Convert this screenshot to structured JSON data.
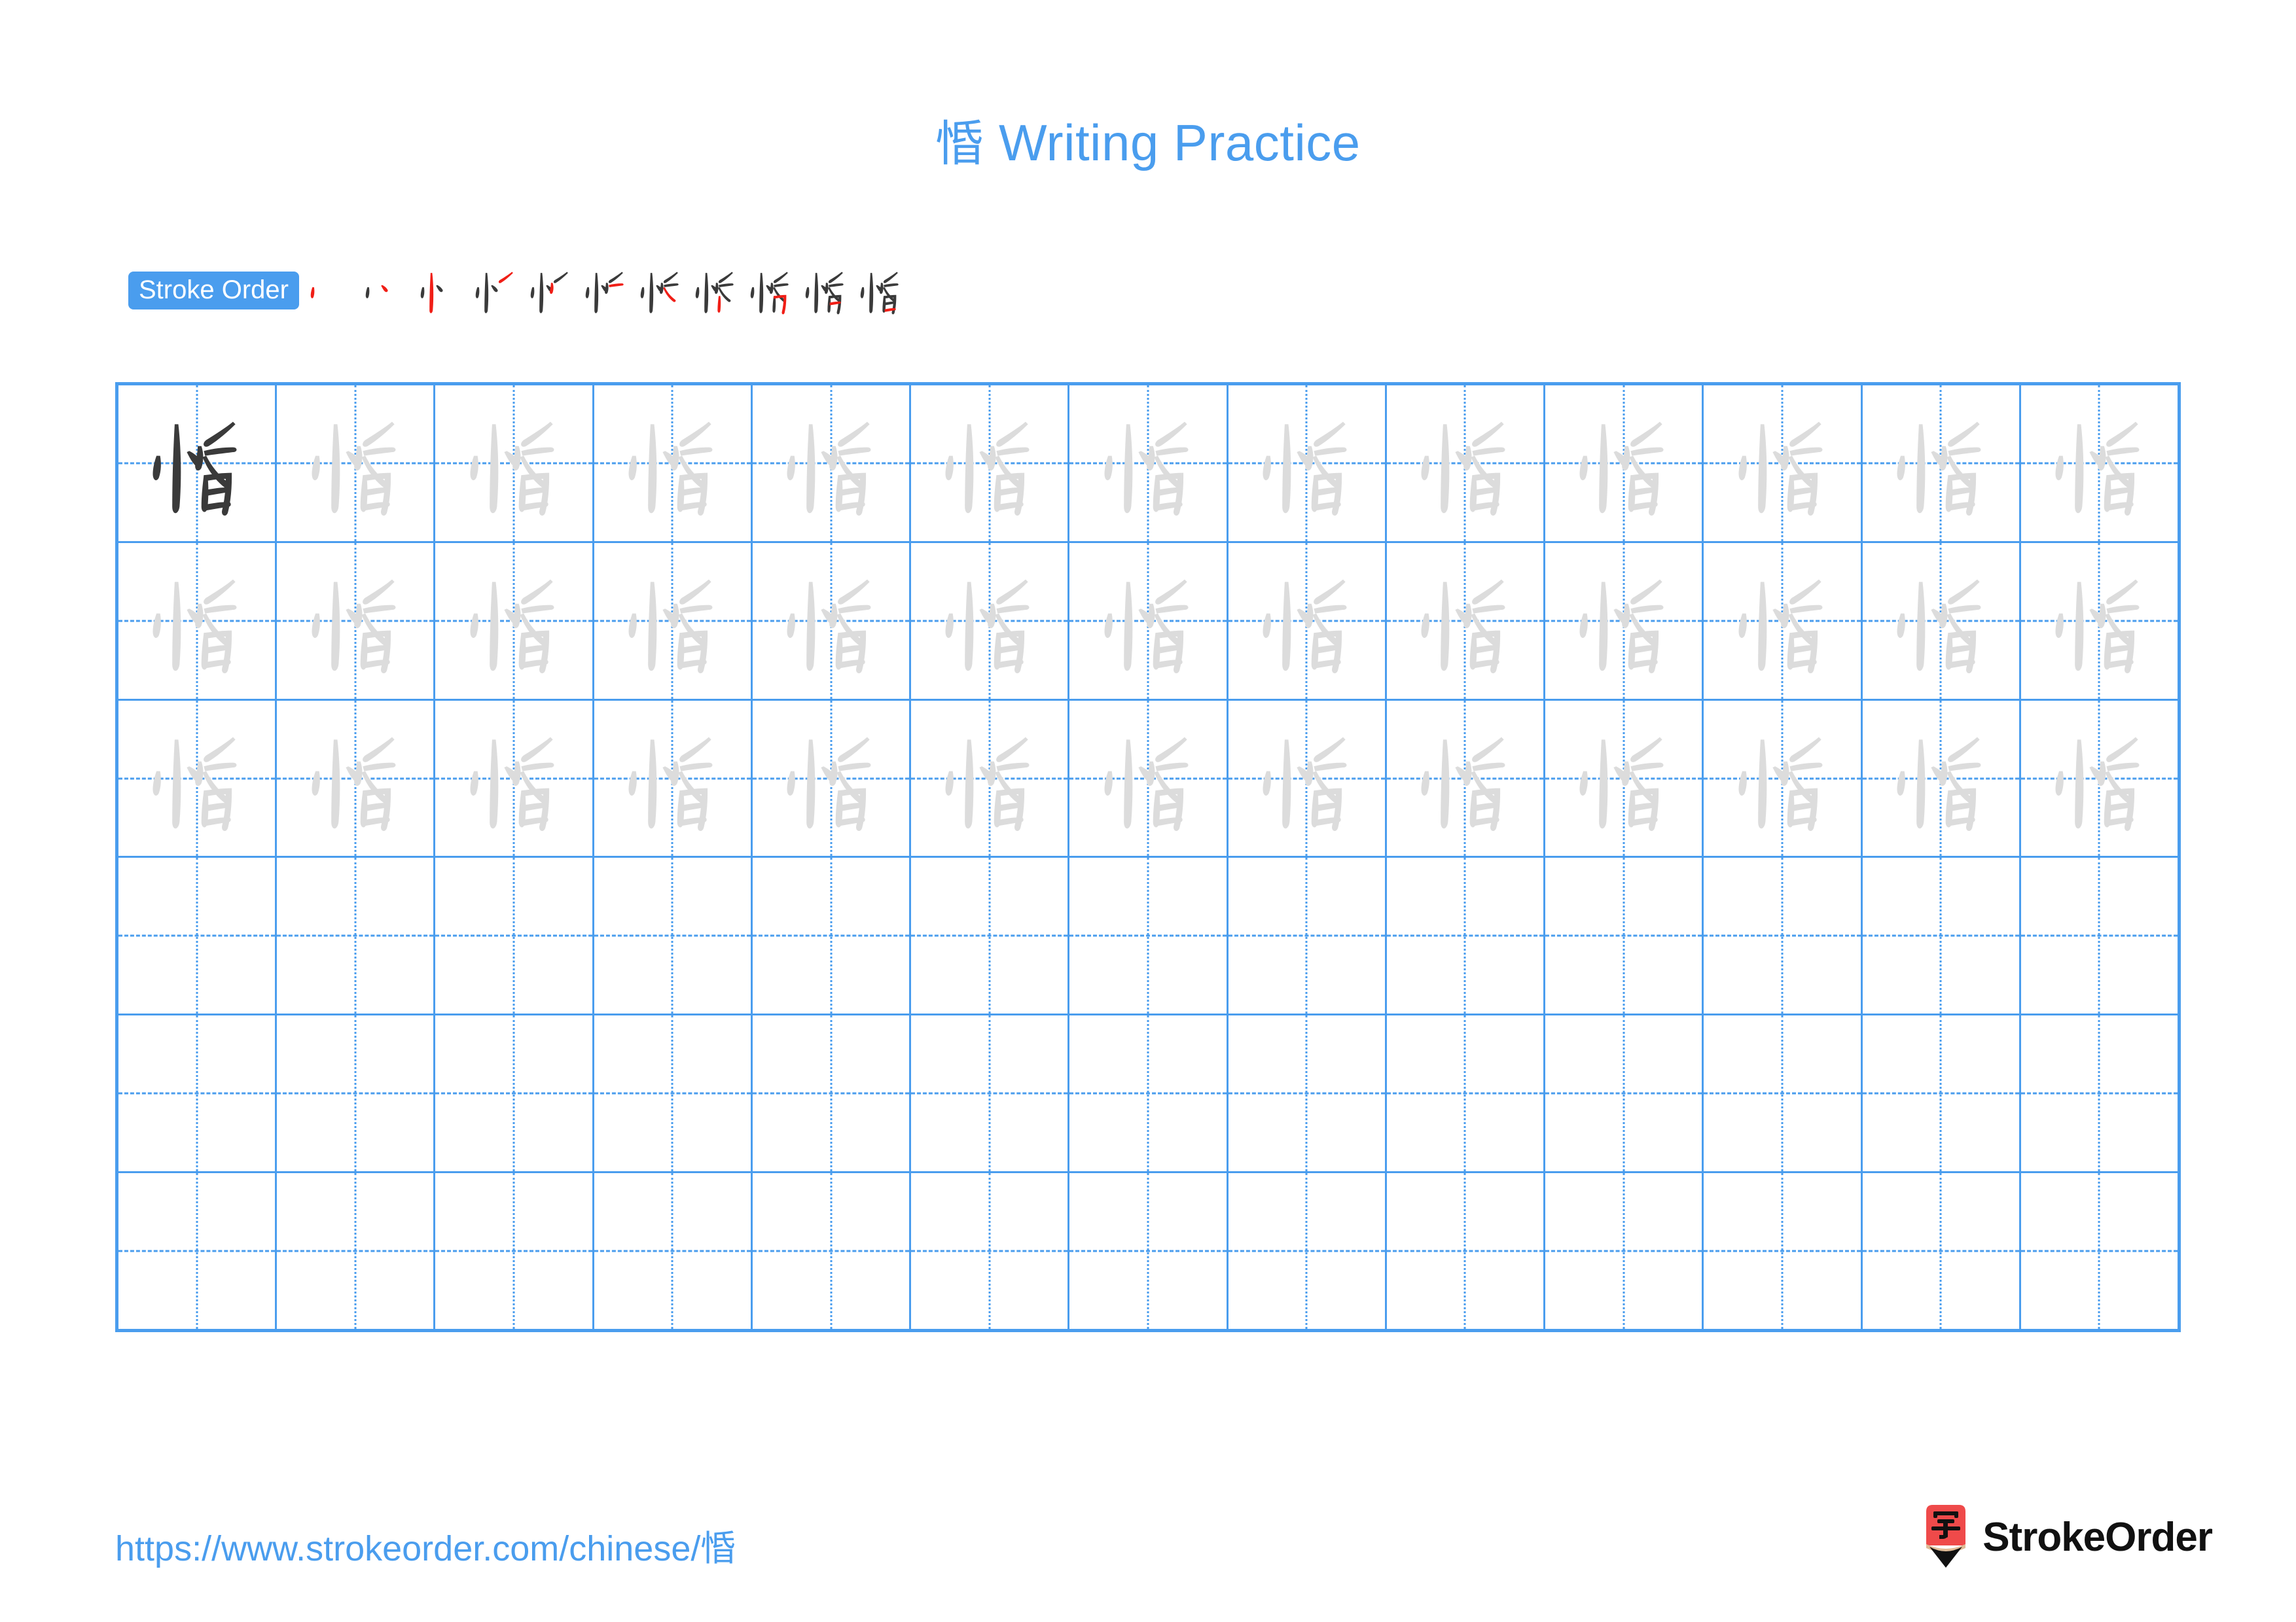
{
  "page": {
    "character": "惛",
    "title_suffix": "Writing Practice",
    "title_full": "惛 Writing Practice",
    "background_color": "#ffffff"
  },
  "colors": {
    "accent_blue": "#4A9DEE",
    "grid_blue": "#4A9DEE",
    "stroke_new_red": "#F01E16",
    "stroke_done_dark": "#3a3a3a",
    "trace_gray": "#dcdcdc",
    "logo_red": "#EF4A4A",
    "logo_wood_tan": "#E0BB96",
    "logo_tip_black": "#111111",
    "brand_text": "#111111"
  },
  "stroke_order": {
    "badge_label": "Stroke Order",
    "total_strokes": 11,
    "steps": [
      {
        "index": 1,
        "name": "stroke-step-1",
        "new_stroke": 1
      },
      {
        "index": 2,
        "name": "stroke-step-2",
        "new_stroke": 2
      },
      {
        "index": 3,
        "name": "stroke-step-3",
        "new_stroke": 3
      },
      {
        "index": 4,
        "name": "stroke-step-4",
        "new_stroke": 4
      },
      {
        "index": 5,
        "name": "stroke-step-5",
        "new_stroke": 5
      },
      {
        "index": 6,
        "name": "stroke-step-6",
        "new_stroke": 6
      },
      {
        "index": 7,
        "name": "stroke-step-7",
        "new_stroke": 7
      },
      {
        "index": 8,
        "name": "stroke-step-8",
        "new_stroke": 8
      },
      {
        "index": 9,
        "name": "stroke-step-9",
        "new_stroke": 9
      },
      {
        "index": 10,
        "name": "stroke-step-10",
        "new_stroke": 10
      },
      {
        "index": 11,
        "name": "stroke-step-11",
        "new_stroke": 11
      }
    ]
  },
  "practice_grid": {
    "columns": 13,
    "rows": 6,
    "filled_rows": 3,
    "empty_rows": 3,
    "cells": [
      [
        "dark",
        "light",
        "light",
        "light",
        "light",
        "light",
        "light",
        "light",
        "light",
        "light",
        "light",
        "light",
        "light"
      ],
      [
        "light",
        "light",
        "light",
        "light",
        "light",
        "light",
        "light",
        "light",
        "light",
        "light",
        "light",
        "light",
        "light"
      ],
      [
        "light",
        "light",
        "light",
        "light",
        "light",
        "light",
        "light",
        "light",
        "light",
        "light",
        "light",
        "light",
        "light"
      ],
      [
        "empty",
        "empty",
        "empty",
        "empty",
        "empty",
        "empty",
        "empty",
        "empty",
        "empty",
        "empty",
        "empty",
        "empty",
        "empty"
      ],
      [
        "empty",
        "empty",
        "empty",
        "empty",
        "empty",
        "empty",
        "empty",
        "empty",
        "empty",
        "empty",
        "empty",
        "empty",
        "empty"
      ],
      [
        "empty",
        "empty",
        "empty",
        "empty",
        "empty",
        "empty",
        "empty",
        "empty",
        "empty",
        "empty",
        "empty",
        "empty",
        "empty"
      ]
    ]
  },
  "footer": {
    "url": "https://www.strokeorder.com/chinese/惛",
    "url_base": "https://www.strokeorder.com/chinese/",
    "brand_name": "StrokeOrder",
    "logo_character": "字"
  }
}
